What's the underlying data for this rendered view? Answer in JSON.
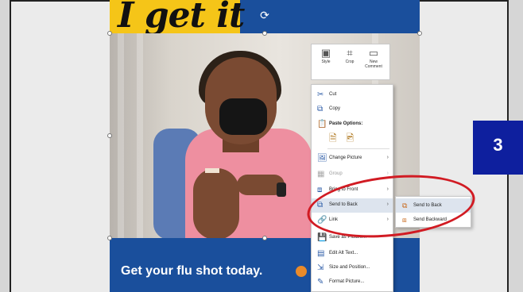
{
  "slide": {
    "headline": "I get it",
    "banner_text": "Get your flu shot today."
  },
  "mini_toolbar": {
    "buttons": [
      {
        "label": "Style",
        "icon": "style-icon"
      },
      {
        "label": "Crop",
        "icon": "crop-icon"
      },
      {
        "label": "New Comment",
        "icon": "comment-icon"
      }
    ]
  },
  "context_menu": {
    "items": [
      {
        "label": "Cut",
        "icon": "scissors-icon"
      },
      {
        "label": "Copy",
        "icon": "copy-icon"
      },
      {
        "label": "Paste Options:",
        "icon": "paste-icon"
      },
      {
        "label": "Change Picture",
        "icon": "change-picture-icon"
      },
      {
        "label": "Group",
        "icon": "group-icon"
      },
      {
        "label": "Bring to Front",
        "icon": "bring-to-front-icon"
      },
      {
        "label": "Send to Back",
        "icon": "send-to-back-icon"
      },
      {
        "label": "Link",
        "icon": "link-icon"
      },
      {
        "label": "Save as Picture...",
        "icon": "save-picture-icon"
      },
      {
        "label": "Edit Alt Text...",
        "icon": "alt-text-icon"
      },
      {
        "label": "Size and Position...",
        "icon": "size-position-icon"
      },
      {
        "label": "Format Picture...",
        "icon": "format-picture-icon"
      }
    ]
  },
  "submenu": {
    "items": [
      {
        "label": "Send to Back",
        "icon": "send-to-back-icon"
      },
      {
        "label": "Send Backward",
        "icon": "send-backward-icon"
      }
    ]
  },
  "step_badge": "3",
  "colors": {
    "accent_blue": "#1a4f9c",
    "headline_yellow": "#f5c518",
    "badge_blue": "#0e1f9e",
    "annotation_red": "#d11b23"
  }
}
